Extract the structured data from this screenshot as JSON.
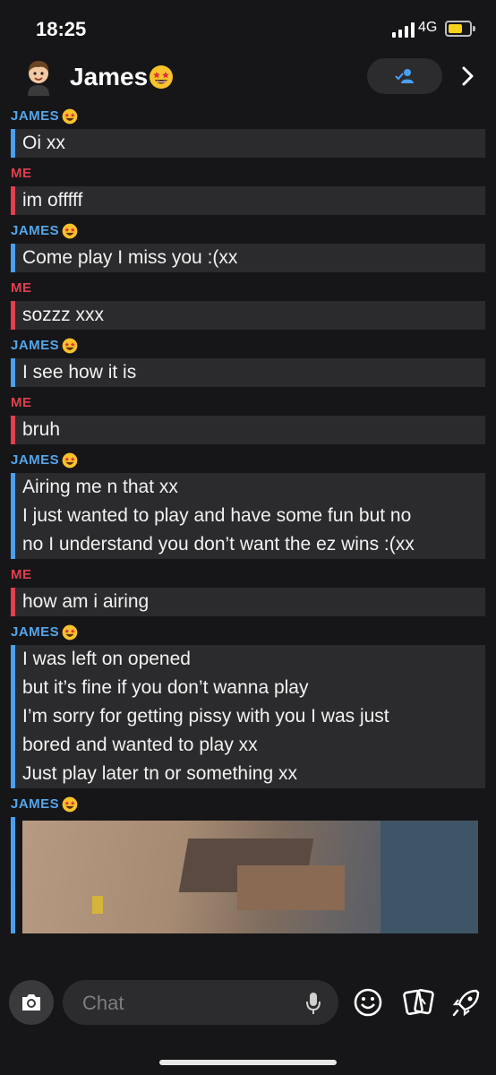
{
  "status_bar": {
    "time": "18:25",
    "network": "4G",
    "battery_color": "#f6d21c"
  },
  "header": {
    "name": "James",
    "name_emoji": "star-struck-emoji",
    "add_friend_icon": "add-friend-icon",
    "chevron_icon": "chevron-right-icon"
  },
  "colors": {
    "james": "#54a6ea",
    "me": "#e0404f",
    "bubble": "#2b2b2d"
  },
  "messages": [
    {
      "sender": "JAMES",
      "lines": [
        "Oi xx"
      ]
    },
    {
      "sender": "ME",
      "lines": [
        "im offfff"
      ]
    },
    {
      "sender": "JAMES",
      "lines": [
        "Come play I miss you :(xx"
      ]
    },
    {
      "sender": "ME",
      "lines": [
        "sozzz xxx"
      ]
    },
    {
      "sender": "JAMES",
      "lines": [
        "I see how it is"
      ]
    },
    {
      "sender": "ME",
      "lines": [
        "bruh"
      ]
    },
    {
      "sender": "JAMES",
      "lines": [
        "Airing me n that xx",
        "I just wanted to play and have some fun but no",
        "no I understand you don’t want the ez wins :(xx"
      ]
    },
    {
      "sender": "ME",
      "lines": [
        "how am i airing"
      ]
    },
    {
      "sender": "JAMES",
      "lines": [
        "I was left on opened",
        "but it’s fine if you don’t wanna play",
        "I’m sorry for getting pissy with you I was just",
        "bored and wanted to play xx",
        "Just play later tn or something xx"
      ]
    },
    {
      "sender": "JAMES",
      "lines": [],
      "media": "video-thumbnail"
    }
  ],
  "composer": {
    "placeholder": "Chat",
    "icons": [
      "camera-icon",
      "microphone-icon",
      "smiley-icon",
      "cards-icon",
      "rocket-icon"
    ]
  }
}
